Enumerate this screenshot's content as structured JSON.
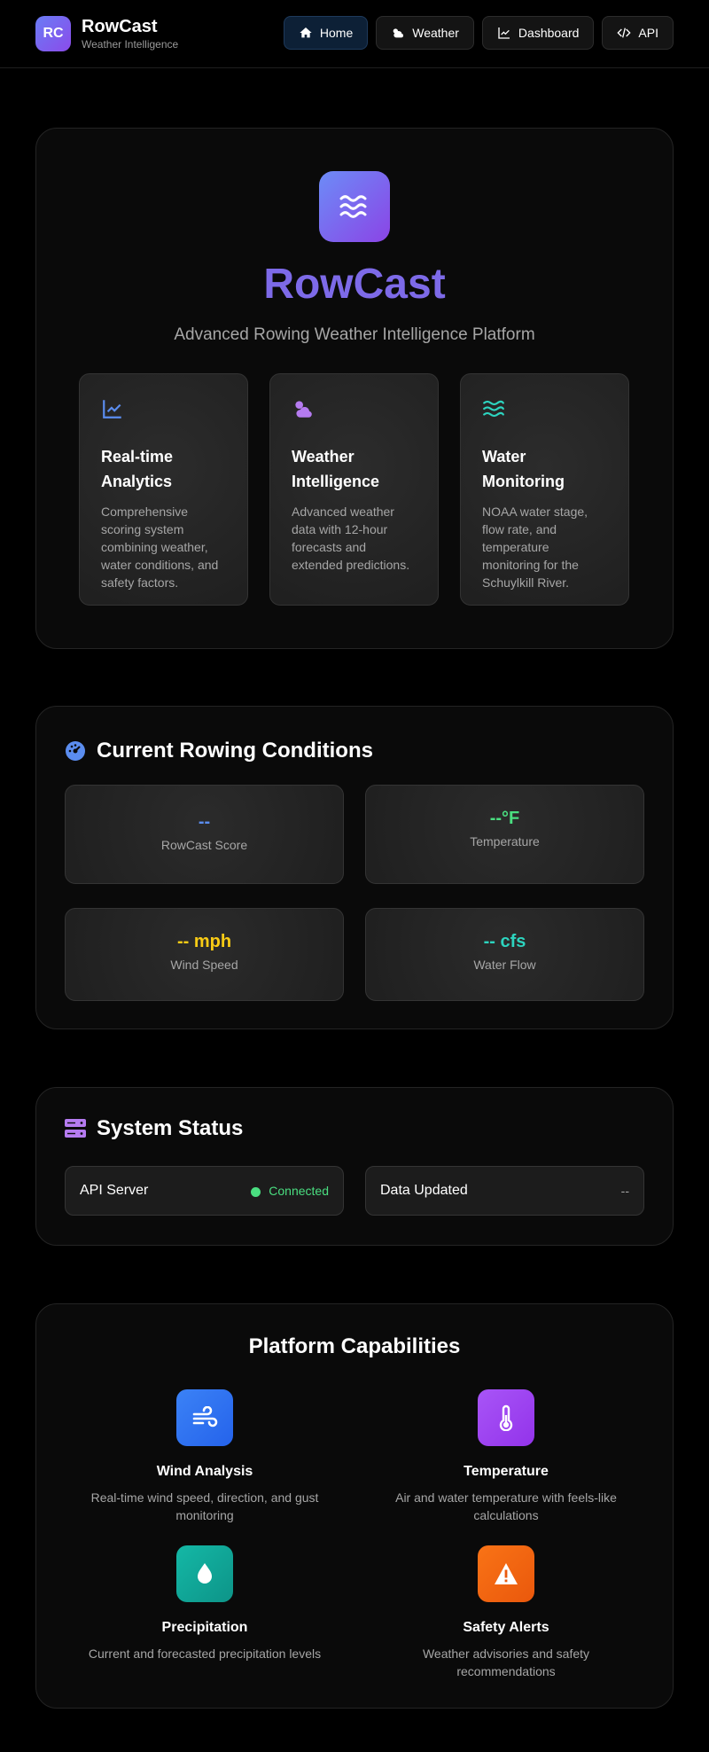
{
  "brand": {
    "logo_text": "RC",
    "name": "RowCast",
    "tagline": "Weather Intelligence"
  },
  "nav": {
    "home": "Home",
    "weather": "Weather",
    "dashboard": "Dashboard",
    "api": "API"
  },
  "hero": {
    "icon": "waves-icon",
    "title": "RowCast",
    "subtitle": "Advanced Rowing Weather Intelligence Platform",
    "features": [
      {
        "icon": "chart-line-icon",
        "color": "#5b8def",
        "title": "Real-time Analytics",
        "description": "Comprehensive scoring system combining weather, water conditions, and safety factors."
      },
      {
        "icon": "cloud-sun-icon",
        "color": "#b57bf0",
        "title": "Weather Intelligence",
        "description": "Advanced weather data with 12-hour forecasts and extended predictions."
      },
      {
        "icon": "water-icon",
        "color": "#2dd4bf",
        "title": "Water Monitoring",
        "description": "NOAA water stage, flow rate, and temperature monitoring for the Schuylkill River."
      }
    ]
  },
  "conditions": {
    "title": "Current Rowing Conditions",
    "icon": "gauge-icon",
    "metrics": [
      {
        "value": "--",
        "label": "RowCast Score",
        "color": "#5b8def"
      },
      {
        "value": "--°F",
        "label": "Temperature",
        "color": "#4ade80"
      },
      {
        "value": "-- mph",
        "label": "Wind Speed",
        "color": "#facc15"
      },
      {
        "value": "-- cfs",
        "label": "Water Flow",
        "color": "#2dd4bf"
      }
    ]
  },
  "status": {
    "title": "System Status",
    "icon": "server-icon",
    "api_label": "API Server",
    "api_value": "Connected",
    "data_label": "Data Updated",
    "data_value": "--"
  },
  "capabilities": {
    "title": "Platform Capabilities",
    "items": [
      {
        "icon": "wind-icon",
        "title": "Wind Analysis",
        "description": "Real-time wind speed, direction, and gust monitoring"
      },
      {
        "icon": "thermometer-icon",
        "title": "Temperature",
        "description": "Air and water temperature with feels-like calculations"
      },
      {
        "icon": "droplet-icon",
        "title": "Precipitation",
        "description": "Current and forecasted precipitation levels"
      },
      {
        "icon": "warning-icon",
        "title": "Safety Alerts",
        "description": "Weather advisories and safety recommendations"
      }
    ]
  }
}
